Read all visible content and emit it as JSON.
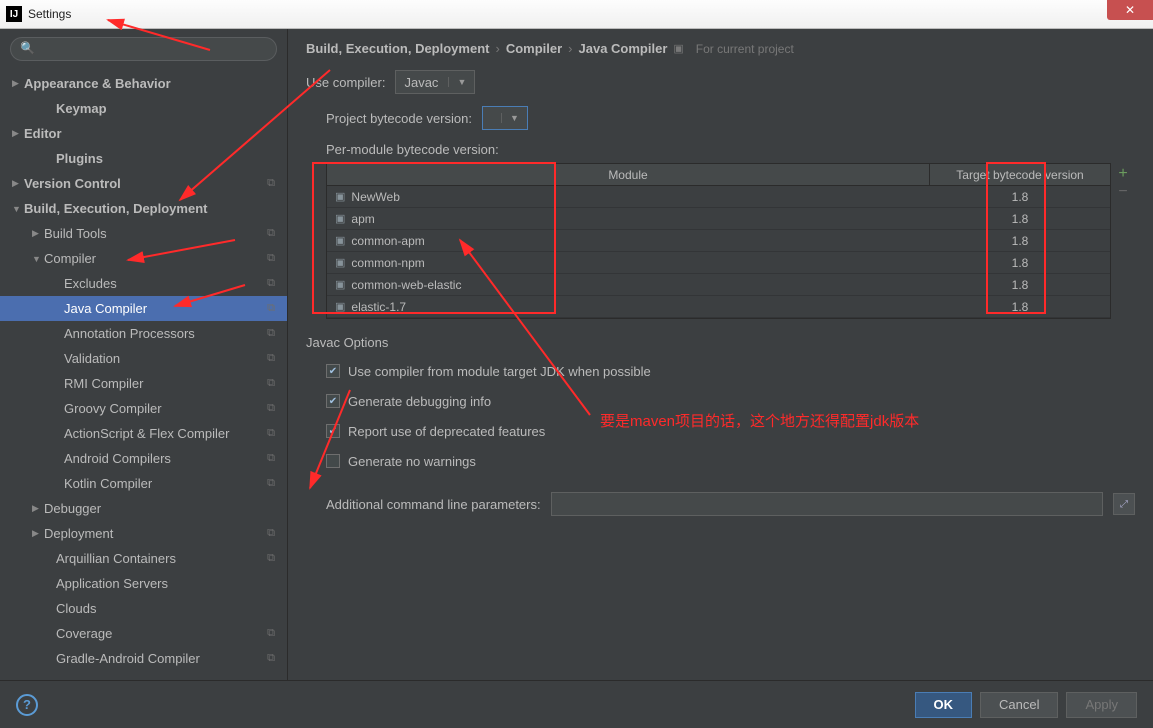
{
  "window": {
    "title": "Settings"
  },
  "breadcrumb": {
    "p1": "Build, Execution, Deployment",
    "p2": "Compiler",
    "p3": "Java Compiler",
    "hint": "For current project"
  },
  "sidebar": {
    "items": [
      {
        "label": "Appearance & Behavior",
        "arrow": "▶",
        "bold": true
      },
      {
        "label": "Keymap",
        "arrow": "",
        "bold": true,
        "level": 1,
        "pad": 1
      },
      {
        "label": "Editor",
        "arrow": "▶",
        "bold": true
      },
      {
        "label": "Plugins",
        "arrow": "",
        "bold": true,
        "level": 1,
        "pad": 1
      },
      {
        "label": "Version Control",
        "arrow": "▶",
        "bold": true,
        "copy": true
      },
      {
        "label": "Build, Execution, Deployment",
        "arrow": "▼",
        "bold": true
      },
      {
        "label": "Build Tools",
        "arrow": "▶",
        "level": 1,
        "copy": true
      },
      {
        "label": "Compiler",
        "arrow": "▼",
        "level": 1,
        "copy": true
      },
      {
        "label": "Excludes",
        "level": 2,
        "copy": true
      },
      {
        "label": "Java Compiler",
        "level": 2,
        "copy": true,
        "selected": true
      },
      {
        "label": "Annotation Processors",
        "level": 2,
        "copy": true
      },
      {
        "label": "Validation",
        "level": 2,
        "copy": true
      },
      {
        "label": "RMI Compiler",
        "level": 2,
        "copy": true
      },
      {
        "label": "Groovy Compiler",
        "level": 2,
        "copy": true
      },
      {
        "label": "ActionScript & Flex Compiler",
        "level": 2,
        "copy": true
      },
      {
        "label": "Android Compilers",
        "level": 2,
        "copy": true
      },
      {
        "label": "Kotlin Compiler",
        "level": 2,
        "copy": true
      },
      {
        "label": "Debugger",
        "arrow": "▶",
        "level": 1
      },
      {
        "label": "Deployment",
        "arrow": "▶",
        "level": 1,
        "copy": true
      },
      {
        "label": "Arquillian Containers",
        "level": 1,
        "copy": true,
        "pad": 1
      },
      {
        "label": "Application Servers",
        "level": 1,
        "pad": 1
      },
      {
        "label": "Clouds",
        "level": 1,
        "pad": 1
      },
      {
        "label": "Coverage",
        "level": 1,
        "copy": true,
        "pad": 1
      },
      {
        "label": "Gradle-Android Compiler",
        "level": 1,
        "copy": true,
        "pad": 1
      }
    ]
  },
  "compiler": {
    "useCompilerLabel": "Use compiler:",
    "useCompilerValue": "Javac",
    "projectBytecodeLabel": "Project bytecode version:",
    "projectBytecodeValue": "",
    "perModuleLabel": "Per-module bytecode version:",
    "cols": {
      "module": "Module",
      "target": "Target bytecode version"
    },
    "modules": [
      {
        "name": "NewWeb",
        "version": "1.8"
      },
      {
        "name": "apm",
        "version": "1.8"
      },
      {
        "name": "common-apm",
        "version": "1.8"
      },
      {
        "name": "common-npm",
        "version": "1.8"
      },
      {
        "name": "common-web-elastic",
        "version": "1.8"
      },
      {
        "name": "elastic-1.7",
        "version": "1.8"
      }
    ]
  },
  "javacOptions": {
    "title": "Javac Options",
    "opt1": "Use compiler from module target JDK when possible",
    "opt2": "Generate debugging info",
    "opt3": "Report use of deprecated features",
    "opt4": "Generate no warnings",
    "paramLabel": "Additional command line parameters:",
    "paramValue": ""
  },
  "footer": {
    "ok": "OK",
    "cancel": "Cancel",
    "apply": "Apply"
  },
  "annotation": {
    "text": "要是maven项目的话，这个地方还得配置jdk版本"
  }
}
